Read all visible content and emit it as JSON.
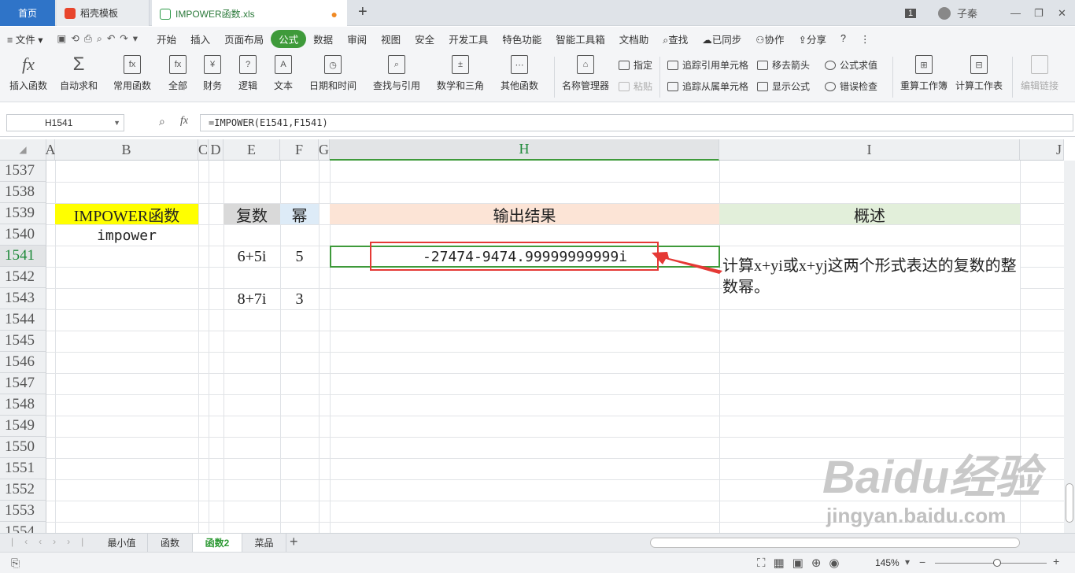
{
  "tabs": {
    "home": "首页",
    "template": "稻壳模板",
    "file": "IMPOWER函数.xls"
  },
  "window": {
    "badge": "1",
    "user": "子秦"
  },
  "menu": {
    "file": "文件",
    "items": [
      "开始",
      "插入",
      "页面布局",
      "公式",
      "数据",
      "审阅",
      "视图",
      "安全",
      "开发工具",
      "特色功能",
      "智能工具箱",
      "文档助"
    ],
    "active": "公式",
    "search": "查找",
    "sync": "已同步",
    "collab": "协作",
    "share": "分享"
  },
  "ribbon": {
    "insert_fn": "插入函数",
    "autosum": "自动求和",
    "common": "常用函数",
    "all": "全部",
    "finance": "财务",
    "logic": "逻辑",
    "text": "文本",
    "datetime": "日期和时间",
    "lookup": "查找与引用",
    "math": "数学和三角",
    "other": "其他函数",
    "name_mgr": "名称管理器",
    "specify": "指定",
    "paste": "粘贴",
    "trace_pre": "追踪引用单元格",
    "trace_dep": "追踪从属单元格",
    "remove_arrow": "移去箭头",
    "show_formula": "显示公式",
    "eval": "公式求值",
    "err_check": "错误检查",
    "recalc_book": "重算工作簿",
    "calc_sheet": "计算工作表",
    "edit_link": "编辑链接"
  },
  "formula": {
    "namebox": "H1541",
    "formula": "=IMPOWER(E1541,F1541)"
  },
  "columns": [
    "A",
    "B",
    "C",
    "D",
    "E",
    "F",
    "G",
    "H",
    "I",
    "J"
  ],
  "rows": [
    "1537",
    "1538",
    "1539",
    "1540",
    "1541",
    "1542",
    "1543",
    "1544",
    "1545",
    "1546",
    "1547",
    "1548",
    "1549",
    "1550",
    "1551",
    "1552",
    "1553",
    "1554"
  ],
  "cells": {
    "title": "IMPOWER函数",
    "name": "impower",
    "h_complex": "复数",
    "h_power": "幂",
    "h_result": "输出结果",
    "h_desc": "概述",
    "c1": "6+5i",
    "p1": "5",
    "result": "-27474-9474.99999999999i",
    "c2": "8+7i",
    "p2": "3",
    "desc": "计算x+yi或x+yj这两个形式表达的复数的整数幂。"
  },
  "colors": {
    "yellow": "#ffff00",
    "gray": "#d9d9d9",
    "blue": "#ddebf7",
    "peach": "#fce4d6",
    "green": "#e2efda",
    "accent": "#3e9a3a",
    "red": "#e53935"
  },
  "sheets": [
    "最小值",
    "函数",
    "函数2",
    "菜品"
  ],
  "active_sheet": "函数2",
  "status": {
    "zoom": "145%"
  },
  "watermark": {
    "brand": "Baidu经验",
    "url": "jingyan.baidu.com"
  }
}
